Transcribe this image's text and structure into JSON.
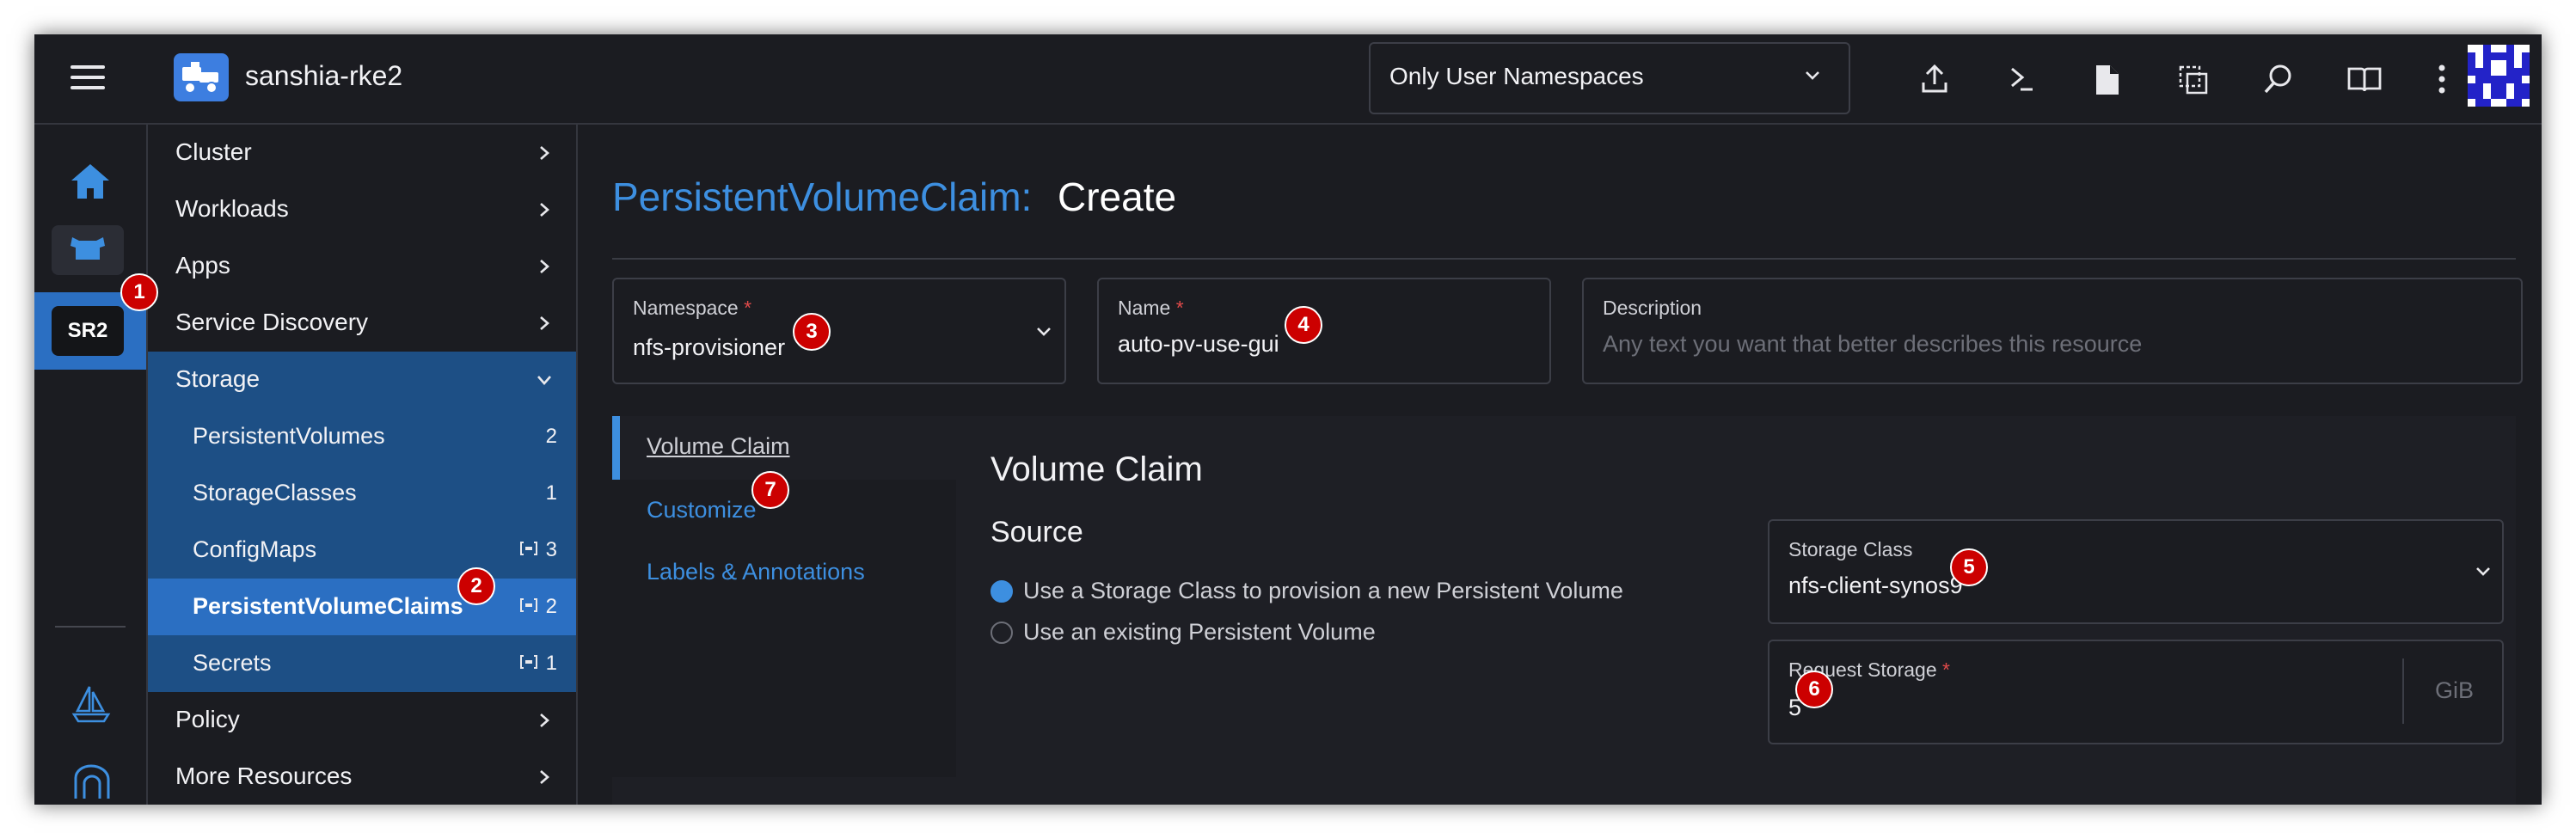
{
  "header": {
    "cluster_name": "sanshia-rke2",
    "namespace_filter": "Only User Namespaces",
    "icons": [
      "menu-icon",
      "import-yaml-icon",
      "kubectl-shell-icon",
      "kubeconfig-download-icon",
      "copy-kubeconfig-icon",
      "search-icon",
      "docs-book-icon",
      "more-vert-icon"
    ]
  },
  "rail": {
    "active_cluster_badge": "SR2"
  },
  "nav": {
    "items": [
      {
        "label": "Cluster"
      },
      {
        "label": "Workloads"
      },
      {
        "label": "Apps"
      },
      {
        "label": "Service Discovery"
      },
      {
        "label": "Storage"
      },
      {
        "label": "Policy"
      },
      {
        "label": "More Resources"
      }
    ],
    "storage_children": [
      {
        "label": "PersistentVolumes",
        "count": "2"
      },
      {
        "label": "StorageClasses",
        "count": "1"
      },
      {
        "label": "ConfigMaps",
        "count": "3"
      },
      {
        "label": "PersistentVolumeClaims",
        "count": "2"
      },
      {
        "label": "Secrets",
        "count": "1"
      }
    ]
  },
  "page": {
    "title_resource": "PersistentVolumeClaim:",
    "title_action": "Create"
  },
  "form": {
    "namespace": {
      "label": "Namespace",
      "required": "*",
      "value": "nfs-provisioner"
    },
    "name": {
      "label": "Name",
      "required": "*",
      "value": "auto-pv-use-gui"
    },
    "description": {
      "label": "Description",
      "placeholder": "Any text you want that better describes this resource"
    }
  },
  "tabs": [
    {
      "label": "Volume Claim"
    },
    {
      "label": "Customize"
    },
    {
      "label": "Labels & Annotations"
    }
  ],
  "volume_claim": {
    "heading": "Volume Claim",
    "source_heading": "Source",
    "source_options": [
      {
        "label": "Use a Storage Class to provision a new Persistent Volume",
        "selected": true
      },
      {
        "label": "Use an existing Persistent Volume",
        "selected": false
      }
    ],
    "storage_class": {
      "label": "Storage Class",
      "value": "nfs-client-synos9"
    },
    "request_storage": {
      "label": "Request Storage",
      "required": "*",
      "value": "5",
      "unit": "GiB"
    }
  },
  "callouts": [
    "1",
    "2",
    "3",
    "4",
    "5",
    "6",
    "7"
  ],
  "colors": {
    "accent": "#3d8fe0",
    "nav_open": "#1d4f85",
    "nav_active": "#2b6fc2",
    "callout": "#cc0000",
    "background": "#1b1c21"
  }
}
